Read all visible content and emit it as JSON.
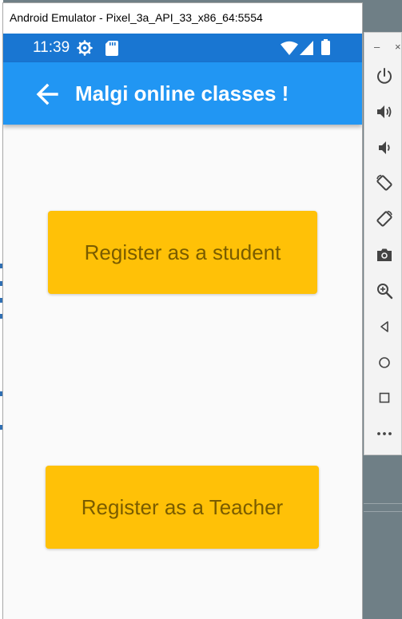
{
  "emulator": {
    "window_title": "Android Emulator - Pixel_3a_API_33_x86_64:5554"
  },
  "status_bar": {
    "time": "11:39",
    "icons": [
      "settings-gear-icon",
      "sd-card-icon",
      "wifi-icon",
      "cell-signal-icon",
      "battery-icon"
    ]
  },
  "app_bar": {
    "back_icon": "back-arrow-icon",
    "title": "Malgi online classes !"
  },
  "main": {
    "student_button_label": "Register as a student",
    "teacher_button_label": "Register as a Teacher"
  },
  "toolbar": {
    "minimize_glyph": "–",
    "close_glyph": "×",
    "buttons": [
      "power-icon",
      "volume-up-icon",
      "volume-down-icon",
      "rotate-left-icon",
      "rotate-right-icon",
      "camera-icon",
      "zoom-icon",
      "back-icon",
      "home-icon",
      "overview-icon",
      "more-icon"
    ]
  },
  "colors": {
    "status_bar": "#1976d2",
    "app_bar": "#2196f3",
    "button": "#ffc107",
    "button_text": "#7a5c00",
    "screen_background": "#fafafa"
  }
}
